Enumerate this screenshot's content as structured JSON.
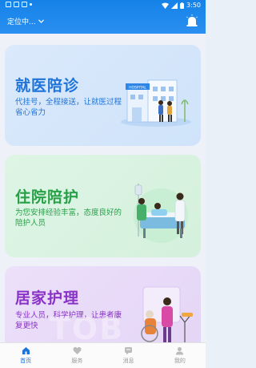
{
  "status_bar": {
    "time": "3:50"
  },
  "header": {
    "location_label": "定位中..."
  },
  "cards": [
    {
      "title": "就医陪诊",
      "description": "代挂号，全程接送，让就医过程省心省力",
      "illustration_sign": "HOSPITAL"
    },
    {
      "title": "住院陪护",
      "description": "为您安排经验丰富，态度良好的陪护人员"
    },
    {
      "title": "居家护理",
      "description": "专业人员，科学护理，让患者康复更快"
    }
  ],
  "bottom_nav": [
    {
      "label": "首页",
      "active": true
    },
    {
      "label": "服务",
      "active": false
    },
    {
      "label": "消息",
      "active": false
    },
    {
      "label": "我的",
      "active": false
    }
  ],
  "colors": {
    "primary": "#1582e8",
    "green": "#27a048",
    "purple": "#8a32c8"
  }
}
